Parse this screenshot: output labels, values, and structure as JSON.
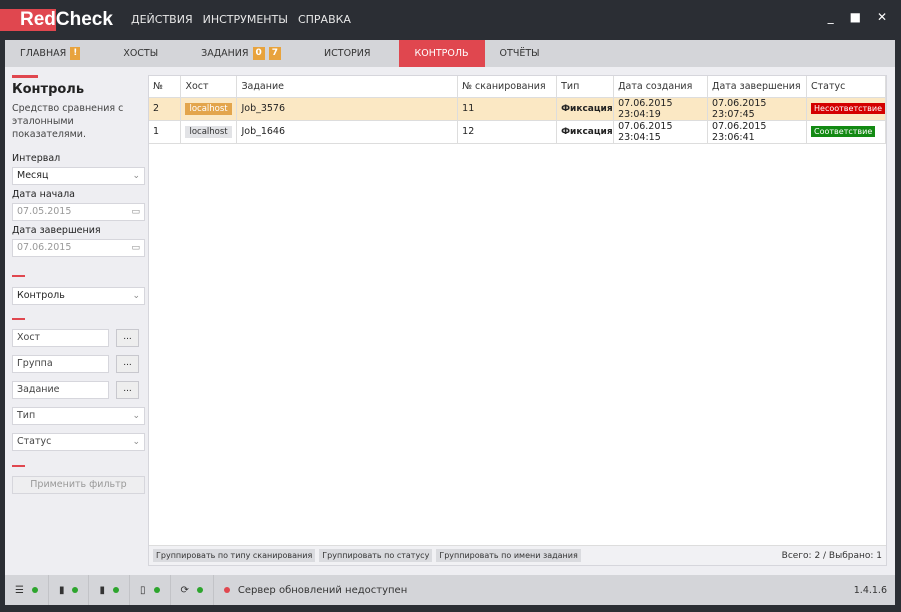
{
  "app": {
    "logo_red": "Red",
    "logo_rest": "Check"
  },
  "menu": [
    "ДЕЙСТВИЯ",
    "ИНСТРУМЕНТЫ",
    "СПРАВКА"
  ],
  "window": {
    "minimize": "_",
    "maximize": "■",
    "close": "✕"
  },
  "tabs": [
    {
      "label": "ГЛАВНАЯ",
      "badges": [
        "!"
      ]
    },
    {
      "label": "ХОСТЫ",
      "badges": []
    },
    {
      "label": "ЗАДАНИЯ",
      "badges": [
        "0",
        "7"
      ]
    },
    {
      "label": "ИСТОРИЯ",
      "badges": []
    },
    {
      "label": "КОНТРОЛЬ",
      "badges": [],
      "active": true
    },
    {
      "label": "ОТЧЁТЫ",
      "badges": []
    }
  ],
  "sidebar": {
    "title": "Контроль",
    "description": "Средство сравнения с эталонными показателями.",
    "interval_label": "Интервал",
    "interval_value": "Месяц",
    "start_label": "Дата начала",
    "start_value": "07.05.2015",
    "end_label": "Дата завершения",
    "end_value": "07.06.2015",
    "type_select": "Контроль",
    "host_placeholder": "Хост",
    "group_placeholder": "Группа",
    "task_placeholder": "Задание",
    "browse": "...",
    "type_placeholder": "Тип",
    "status_placeholder": "Статус",
    "apply": "Применить фильтр"
  },
  "table": {
    "columns": [
      "№",
      "Хост",
      "Задание",
      "№ сканирования",
      "Тип",
      "Дата создания",
      "Дата завершения",
      "Статус"
    ],
    "rows": [
      {
        "n": "2",
        "host": "localhost",
        "task": "Job_3576",
        "scan": "11",
        "type": "Фиксация",
        "created": "07.06.2015 23:04:19",
        "finished": "07.06.2015 23:07:45",
        "status": "Несоответствие",
        "status_color": "#d40000",
        "selected": true
      },
      {
        "n": "1",
        "host": "localhost",
        "task": "Job_1646",
        "scan": "12",
        "type": "Фиксация",
        "created": "07.06.2015 23:04:15",
        "finished": "07.06.2015 23:06:41",
        "status": "Соответствие",
        "status_color": "#138a13",
        "selected": false
      }
    ]
  },
  "groupby": [
    "Группировать по типу сканирования",
    "Группировать по статусу",
    "Группировать по имени задания"
  ],
  "total": "Всего: 2 / Выбрано: 1",
  "statusbar": {
    "message": "Сервер обновлений недоступен",
    "version": "1.4.1.6"
  },
  "colors": {
    "accent": "#e0474f",
    "badge": "#e8a33d",
    "ok": "#2da52d"
  }
}
